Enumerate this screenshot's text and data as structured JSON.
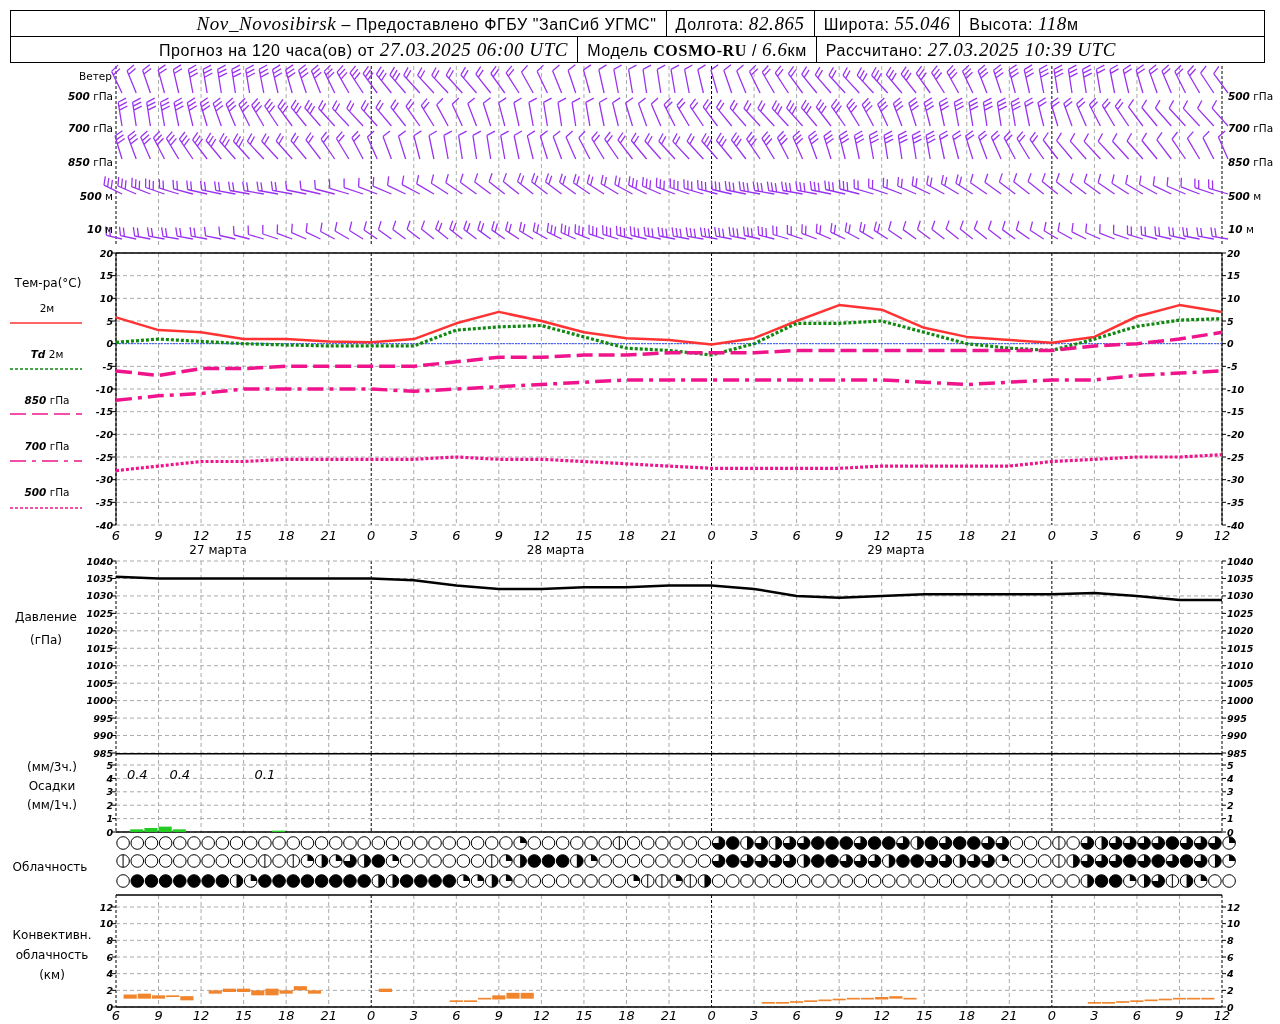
{
  "header": {
    "rows": [
      [
        {
          "text": "*Nov_Novosibirsk* – Предоставлено ФГБУ \"ЗапСиб УГМС\""
        },
        {
          "text": "Долгота: *82.865*"
        },
        {
          "text": "Широта: *55.046*"
        },
        {
          "text": "Высота: *118*",
          "unit": "м"
        }
      ],
      [
        {
          "text": "Прогноз на 120 часа(ов) от *27.03.2025 06:00 UTC*"
        },
        {
          "text": "Модель **COSMO-RU** / *6.6*",
          "unit": "км"
        },
        {
          "text": "Рассчитано: *27.03.2025 10:39 UTC*"
        }
      ]
    ]
  },
  "wind": {
    "title": "Ветер",
    "levels_left": [
      {
        "value": "500",
        "unit": "гПа"
      },
      {
        "value": "700",
        "unit": "гПа"
      },
      {
        "value": "850",
        "unit": "гПа"
      },
      {
        "value": "500",
        "unit": "м"
      },
      {
        "value": "10",
        "unit": "м"
      }
    ],
    "levels_right": [
      {
        "value": "500",
        "unit": "гПа"
      },
      {
        "value": "700",
        "unit": "гПа"
      },
      {
        "value": "850",
        "unit": "гПа"
      },
      {
        "value": "500",
        "unit": "м"
      },
      {
        "value": "10",
        "unit": "м"
      }
    ]
  },
  "temperature": {
    "title": "Тем-ра(°C)",
    "legend": [
      {
        "label": "2м"
      },
      {
        "prefix": "Td",
        "label": "2м"
      },
      {
        "prefix": "850",
        "label": "гПа"
      },
      {
        "prefix": "700",
        "label": "гПа"
      },
      {
        "prefix": "500",
        "label": "гПа"
      }
    ],
    "dates": [
      "27 марта",
      "28 марта",
      "29 марта"
    ],
    "right_ticks": [
      "20",
      "15",
      "10",
      "5",
      "0",
      "-5",
      "-10",
      "-15",
      "-20",
      "-25",
      "-30",
      "-35",
      "-40"
    ],
    "chart_data": {
      "type": "line",
      "grid": true,
      "categories": [
        "6",
        "9",
        "12",
        "15",
        "18",
        "21",
        "0",
        "3",
        "6",
        "9",
        "12",
        "15",
        "18",
        "21",
        "0",
        "3",
        "6",
        "9",
        "12",
        "15",
        "18",
        "21",
        "0",
        "3",
        "6",
        "9",
        "12"
      ],
      "ylim": [
        -40,
        20
      ],
      "yticks": [
        20,
        15,
        10,
        5,
        0,
        -5,
        -10,
        -15,
        -20,
        -25,
        -30,
        -35,
        -40
      ],
      "ref_lines": [
        {
          "axis": "y",
          "value": 0,
          "color": "#3355ff"
        }
      ],
      "series": [
        {
          "color": "#ff3333",
          "line_style": "solid",
          "values": [
            5.8,
            3,
            2.5,
            1,
            1,
            0.5,
            0.3,
            1,
            4.5,
            7,
            5,
            2.5,
            1.2,
            0.8,
            -0.2,
            1.2,
            5,
            8.5,
            7.5,
            3.5,
            1.5,
            0.8,
            0.2,
            1.5,
            6,
            8.5,
            7
          ]
        },
        {
          "color": "#118811",
          "line_style": "dotted",
          "values": [
            0.3,
            1,
            0.5,
            0,
            -0.3,
            -0.5,
            -0.5,
            -0.5,
            3,
            3.7,
            4,
            1.5,
            -1,
            -1.5,
            -2.5,
            0,
            4.5,
            4.5,
            5,
            2.5,
            0,
            -1,
            -1.5,
            1,
            3.8,
            5.2,
            5.5
          ]
        },
        {
          "color": "#f0148c",
          "line_style": "dashed",
          "values": [
            -6,
            -7,
            -5.5,
            -5.5,
            -5,
            -5,
            -5,
            -5,
            -4,
            -3,
            -3,
            -2.5,
            -2.5,
            -2,
            -2,
            -2,
            -1.5,
            -1.5,
            -1.5,
            -1.5,
            -1.5,
            -1.5,
            -1.5,
            -0.5,
            0,
            1,
            2.5
          ]
        },
        {
          "color": "#f0148c",
          "line_style": "dashdot",
          "values": [
            -12.5,
            -11.5,
            -11,
            -10,
            -10,
            -10,
            -10,
            -10.5,
            -10,
            -9.5,
            -9,
            -8.5,
            -8,
            -8,
            -8,
            -8,
            -8,
            -8,
            -8,
            -8.5,
            -9,
            -8.5,
            -8,
            -8,
            -7,
            -6.5,
            -6
          ]
        },
        {
          "color": "#f0148c",
          "line_style": "dotted",
          "values": [
            -28,
            -27,
            -26,
            -26,
            -25.5,
            -25.5,
            -25.5,
            -25.5,
            -25,
            -25.5,
            -25.5,
            -26,
            -26.5,
            -27,
            -27.5,
            -27.5,
            -27.5,
            -27.5,
            -27,
            -27,
            -27,
            -27,
            -26,
            -25.5,
            -25,
            -25,
            -24.5
          ]
        }
      ]
    }
  },
  "pressure": {
    "labels": [
      "Давление",
      "(гПа)"
    ],
    "right_ticks": [
      "1040",
      "1035",
      "1030",
      "1025",
      "1020",
      "1015",
      "1010",
      "1005",
      "1000",
      "995",
      "990",
      "985"
    ],
    "chart_data": {
      "type": "line",
      "grid": true,
      "categories": [
        null,
        null,
        null,
        null,
        null,
        null,
        null,
        null,
        null,
        null,
        null,
        null,
        null,
        null,
        null,
        null,
        null,
        null,
        null,
        null,
        null,
        null,
        null,
        null,
        null,
        null,
        null
      ],
      "ylim": [
        985,
        1040
      ],
      "yticks": [
        1040,
        1035,
        1030,
        1025,
        1020,
        1015,
        1010,
        1005,
        1000,
        995,
        990,
        985
      ],
      "series": [
        {
          "color": "#000000",
          "line_style": "solid",
          "values": [
            1035.5,
            1035,
            1035,
            1035,
            1035,
            1035,
            1035,
            1034.5,
            1033,
            1032,
            1032,
            1032.5,
            1032.5,
            1033,
            1033,
            1032,
            1030,
            1029.5,
            1030,
            1030.5,
            1030.5,
            1030.5,
            1030.5,
            1030.8,
            1030,
            1028.8,
            1028.8
          ]
        }
      ]
    }
  },
  "precipitation": {
    "labels": [
      "(мм/3ч.)",
      "Осадки",
      "(мм/1ч.)"
    ],
    "right_ticks": [
      "5",
      "4",
      "3",
      "2",
      "1",
      "0"
    ],
    "chart_data": {
      "type": "bar",
      "grid": true,
      "ylim": [
        0,
        5
      ],
      "yticks": [
        5,
        4,
        3,
        2,
        1,
        0
      ],
      "categories": [
        null,
        null,
        null,
        null,
        null,
        null,
        null,
        null,
        null,
        null,
        null,
        null,
        null,
        null,
        null,
        null,
        null,
        null,
        null,
        null,
        null,
        null,
        null,
        null,
        null,
        null,
        null,
        null,
        null,
        null,
        null,
        null,
        null,
        null,
        null,
        null,
        null,
        null,
        null,
        null,
        null,
        null,
        null,
        null,
        null,
        null,
        null,
        null,
        null,
        null,
        null,
        null,
        null,
        null,
        null,
        null,
        null,
        null,
        null,
        null,
        null,
        null,
        null,
        null,
        null,
        null,
        null,
        null,
        null,
        null,
        null,
        null,
        null,
        null,
        null,
        null,
        null,
        null,
        null
      ],
      "series": [
        {
          "color": "#22cc22",
          "values": [
            null,
            0.2,
            0.3,
            0.4,
            0.2,
            null,
            null,
            null,
            null,
            null,
            null,
            0.1,
            null,
            null,
            null,
            null,
            null,
            null,
            null,
            null,
            null,
            null,
            null,
            null,
            null,
            null,
            null,
            null,
            null,
            null,
            null,
            null,
            null,
            null,
            null,
            null,
            null,
            null,
            null,
            null,
            null,
            null,
            null,
            null,
            null,
            null,
            null,
            null,
            null,
            null,
            null,
            null,
            null,
            null,
            null,
            null,
            null,
            null,
            null,
            null,
            null,
            null,
            null,
            null,
            null,
            null,
            null,
            null,
            null,
            null,
            null,
            null,
            null,
            null,
            null,
            null,
            null,
            null,
            null
          ]
        }
      ],
      "annotations": [
        "0.4",
        "0.4",
        "0.1"
      ]
    }
  },
  "cloudiness": {
    "label": "Облачность"
  },
  "convective": {
    "labels": [
      "Конвективн.",
      "облачность",
      "(км)"
    ],
    "right_ticks": [
      "12",
      "10",
      "8",
      "6",
      "4",
      "2",
      "0"
    ],
    "chart_data": {
      "type": "candlestick",
      "grid": true,
      "ylim": [
        0,
        12
      ],
      "yticks": [
        12,
        10,
        8,
        6,
        4,
        2,
        0
      ],
      "categories": [
        "6",
        null,
        null,
        "9",
        null,
        null,
        "12",
        null,
        null,
        "15",
        null,
        null,
        "18",
        null,
        null,
        "21",
        null,
        null,
        "0",
        null,
        null,
        "3",
        null,
        null,
        "6",
        null,
        null,
        "9",
        null,
        null,
        "12",
        null,
        null,
        "15",
        null,
        null,
        "18",
        null,
        null,
        "21",
        null,
        null,
        "0",
        null,
        null,
        "3",
        null,
        null,
        "6",
        null,
        null,
        "9",
        null,
        null,
        "12",
        null,
        null,
        "15",
        null,
        null,
        "18",
        null,
        null,
        "21",
        null,
        null,
        "0",
        null,
        null,
        "3",
        null,
        null,
        "6",
        null,
        null,
        "9",
        null,
        null,
        "12"
      ],
      "series": [
        {
          "color": "#f0852d",
          "ohlc": [
            null,
            [
              1.0,
              1.5,
              1.0,
              1.5
            ],
            [
              1.0,
              1.6,
              1.0,
              1.6
            ],
            [
              1.0,
              1.4,
              1.0,
              1.4
            ],
            [
              1.2,
              1.4,
              1.2,
              1.4
            ],
            [
              0.8,
              1.3,
              0.8,
              1.3
            ],
            null,
            [
              1.6,
              2.0,
              1.6,
              2.0
            ],
            [
              1.8,
              2.2,
              1.8,
              2.2
            ],
            [
              1.8,
              2.2,
              1.8,
              2.2
            ],
            [
              1.4,
              2.0,
              1.4,
              2.0
            ],
            [
              1.4,
              2.2,
              1.4,
              2.2
            ],
            [
              1.6,
              2.0,
              1.6,
              2.0
            ],
            [
              2.0,
              2.5,
              2.0,
              2.5
            ],
            [
              1.6,
              2.0,
              1.6,
              2.0
            ],
            null,
            null,
            null,
            null,
            [
              1.8,
              2.2,
              1.8,
              2.2
            ],
            null,
            null,
            null,
            null,
            [
              0.6,
              0.8,
              0.6,
              0.8
            ],
            [
              0.6,
              0.8,
              0.6,
              0.8
            ],
            [
              0.9,
              1.1,
              0.9,
              1.1
            ],
            [
              0.9,
              1.4,
              0.9,
              1.4
            ],
            [
              1.0,
              1.7,
              1.0,
              1.7
            ],
            [
              1.0,
              1.7,
              1.0,
              1.7
            ],
            null,
            null,
            null,
            null,
            null,
            null,
            null,
            null,
            null,
            null,
            null,
            null,
            null,
            null,
            null,
            null,
            [
              0.4,
              0.6,
              0.4,
              0.6
            ],
            [
              0.4,
              0.6,
              0.4,
              0.6
            ],
            [
              0.5,
              0.7,
              0.5,
              0.7
            ],
            [
              0.6,
              0.8,
              0.6,
              0.8
            ],
            [
              0.7,
              0.9,
              0.7,
              0.9
            ],
            [
              0.8,
              1.0,
              0.8,
              1.0
            ],
            [
              0.9,
              1.1,
              0.9,
              1.1
            ],
            [
              0.9,
              1.1,
              0.9,
              1.1
            ],
            [
              0.9,
              1.2,
              0.9,
              1.2
            ],
            [
              1.0,
              1.3,
              1.0,
              1.3
            ],
            [
              0.9,
              1.1,
              0.9,
              1.1
            ],
            null,
            null,
            null,
            null,
            null,
            null,
            null,
            null,
            null,
            null,
            null,
            null,
            [
              0.4,
              0.6,
              0.4,
              0.6
            ],
            [
              0.4,
              0.6,
              0.4,
              0.6
            ],
            [
              0.5,
              0.7,
              0.5,
              0.7
            ],
            [
              0.6,
              0.8,
              0.6,
              0.8
            ],
            [
              0.7,
              0.9,
              0.7,
              0.9
            ],
            [
              0.8,
              1.0,
              0.8,
              1.0
            ],
            [
              0.9,
              1.1,
              0.9,
              1.1
            ],
            [
              0.9,
              1.1,
              0.9,
              1.1
            ],
            [
              0.9,
              1.1,
              0.9,
              1.1
            ],
            null
          ]
        }
      ]
    }
  }
}
